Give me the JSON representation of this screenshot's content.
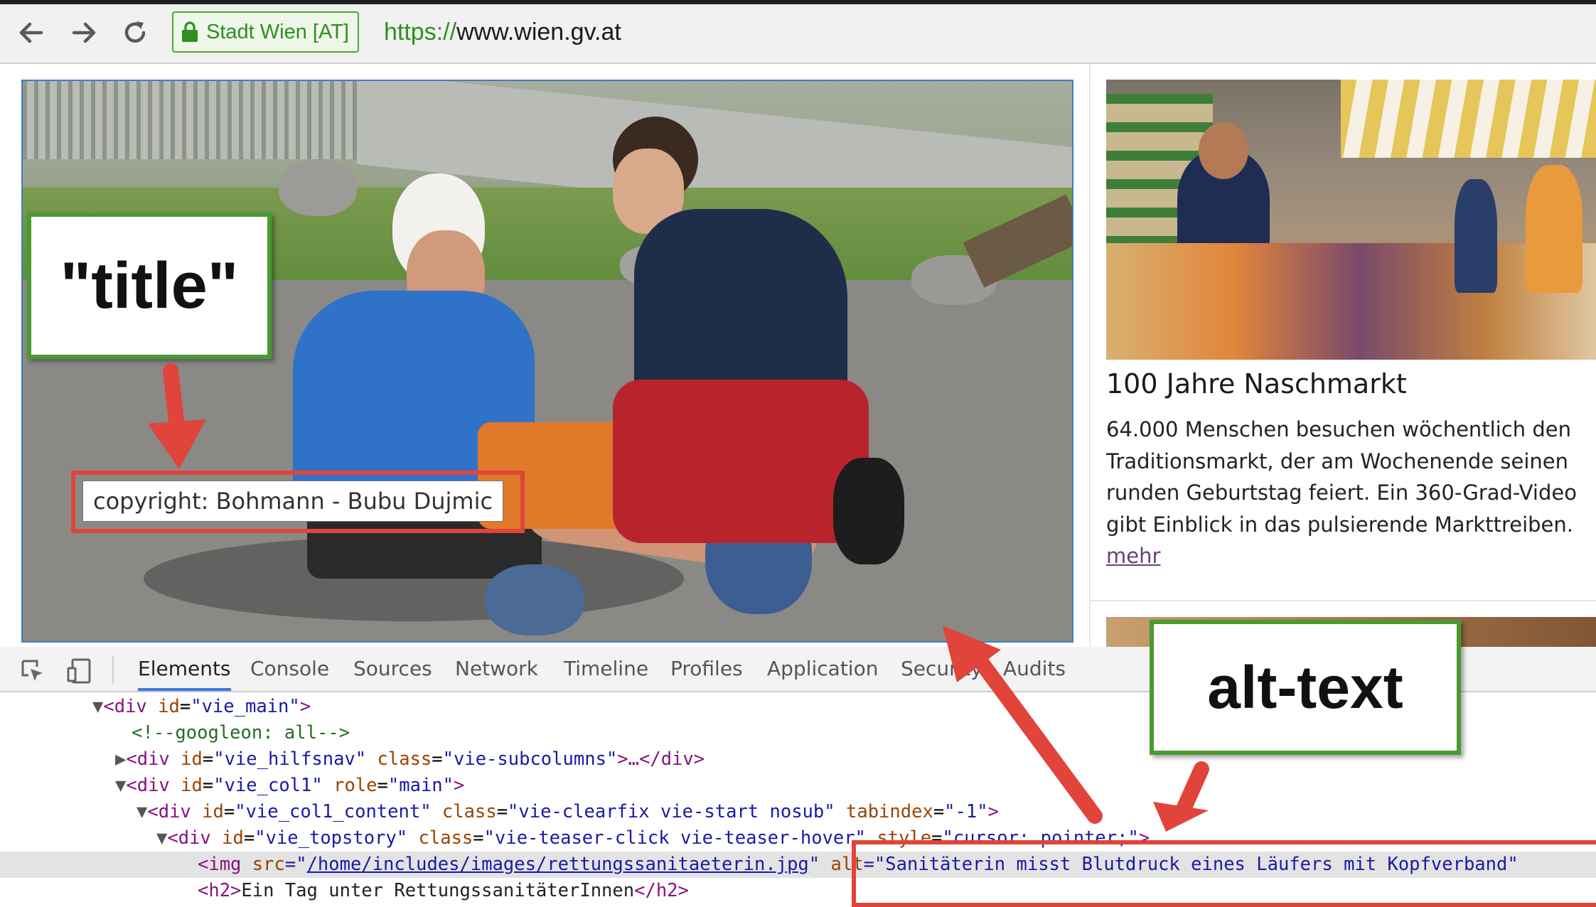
{
  "browser": {
    "security_label": "Stadt Wien [AT]",
    "url_scheme": "https://",
    "url_host": "www.wien.gv.at"
  },
  "page": {
    "hero": {
      "title_tooltip": "copyright: Bohmann - Bubu Dujmic"
    },
    "teaser": {
      "heading": "100 Jahre Naschmarkt",
      "body": "64.000 Menschen besuchen wöchentlich den Traditionsmarkt, der am Wochenende seinen runden Geburtstag feiert. Ein 360-Grad-Video gibt Einblick in das pulsierende Markttreiben.",
      "more_link": "mehr"
    }
  },
  "annotations": {
    "title_label": "\"title\"",
    "alt_label": "alt-text",
    "callout_color": "#4a9a32",
    "highlight_color": "#e0443a"
  },
  "devtools": {
    "tabs": [
      "Elements",
      "Console",
      "Sources",
      "Network",
      "Timeline",
      "Profiles",
      "Application",
      "Security",
      "Audits"
    ],
    "active_tab": "Elements",
    "dom": {
      "l1": {
        "tri": "▼",
        "tag_open": "<div",
        "attr": "id",
        "val": "\"vie_main\"",
        "tag_close": ">"
      },
      "l2": {
        "comment": "<!--googleon: all-->"
      },
      "l3": {
        "tri": "▶",
        "tag_open": "<div",
        "attr1": "id",
        "val1": "\"vie_hilfsnav\"",
        "attr2": "class",
        "val2": "\"vie-subcolumns\"",
        "tag_close": ">…</div>"
      },
      "l4": {
        "tri": "▼",
        "tag_open": "<div",
        "attr1": "id",
        "val1": "\"vie_col1\"",
        "attr2": "role",
        "val2": "\"main\"",
        "tag_close": ">"
      },
      "l5": {
        "tri": "▼",
        "tag_open": "<div",
        "attr1": "id",
        "val1": "\"vie_col1_content\"",
        "attr2": "class",
        "val2": "\"vie-clearfix vie-start nosub\"",
        "attr3": "tabindex",
        "val3": "\"-1\"",
        "tag_close": ">"
      },
      "l6": {
        "tri": "▼",
        "tag_open": "<div",
        "attr1": "id",
        "val1": "\"vie_topstory\"",
        "attr2": "class",
        "val2": "\"vie-teaser-click vie-teaser-hover\"",
        "attr3": "style",
        "val3": "\"cursor: pointer;\"",
        "tag_close": ">"
      },
      "l7": {
        "tag_open": "<img",
        "attr1": "src",
        "q_open": "=\"",
        "link": "/home/includes/images/rettungssanitaeterin.jpg",
        "q_close": "\"",
        "attr2": "alt",
        "val2": "=\"Sanitäterin misst Blutdruck eines Läufers mit Kopfverband\""
      },
      "l8": {
        "tag_open": "<h2>",
        "text": "Ein Tag unter RettungssanitäterInnen",
        "tag_close": "</h2>"
      }
    }
  }
}
